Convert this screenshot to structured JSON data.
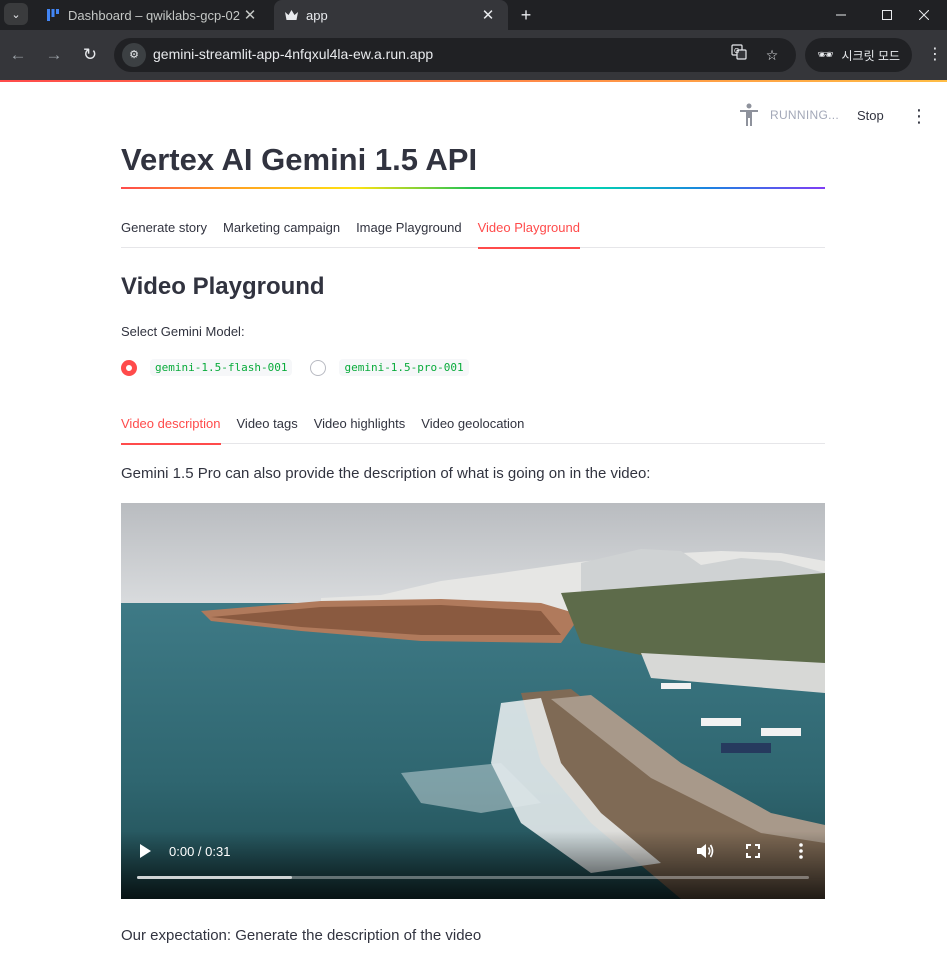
{
  "browser": {
    "tabs": [
      {
        "title": "Dashboard – qwiklabs-gcp-02-",
        "active": false
      },
      {
        "title": "app",
        "active": true
      }
    ],
    "url": "gemini-streamlit-app-4nfqxul4la-ew.a.run.app",
    "incognito_label": "시크릿 모드"
  },
  "status": {
    "running": "RUNNING...",
    "stop": "Stop"
  },
  "page": {
    "title": "Vertex AI Gemini 1.5 API",
    "tabs": [
      "Generate story",
      "Marketing campaign",
      "Image Playground",
      "Video Playground"
    ],
    "active_tab": "Video Playground",
    "section_title": "Video Playground",
    "model_label": "Select Gemini Model:",
    "models": [
      {
        "label": "gemini-1.5-flash-001",
        "selected": true
      },
      {
        "label": "gemini-1.5-pro-001",
        "selected": false
      }
    ],
    "inner_tabs": [
      "Video description",
      "Video tags",
      "Video highlights",
      "Video geolocation"
    ],
    "active_inner_tab": "Video description",
    "description": "Gemini 1.5 Pro can also provide the description of what is going on in the video:",
    "video": {
      "time": "0:00 / 0:31",
      "buffered_fraction": 0.23
    },
    "expectation": "Our expectation: Generate the description of the video"
  },
  "colors": {
    "accent": "#ff4b4b",
    "code_green": "#09ab3b",
    "text": "#31333f"
  }
}
